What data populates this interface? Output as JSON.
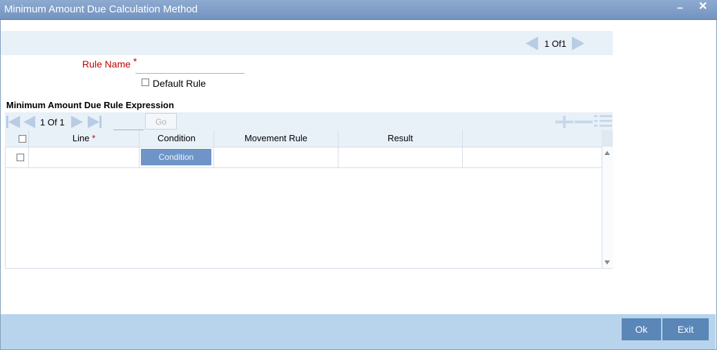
{
  "window": {
    "title": "Minimum Amount Due Calculation Method",
    "minimize_icon": "minimize-icon",
    "close_icon": "close-icon"
  },
  "record_nav": {
    "current": "1",
    "of_label": "Of",
    "total": "1"
  },
  "form": {
    "rule_name_label": "Rule Name",
    "required_mark": "*",
    "rule_name_value": "",
    "default_rule_label": "Default Rule",
    "default_rule_checked": false
  },
  "section": {
    "title": "Minimum Amount Due Rule Expression"
  },
  "grid": {
    "page_current": "1",
    "page_of": "Of",
    "page_total": "1",
    "go_label": "Go",
    "page_input_value": "",
    "columns": [
      {
        "label": "Line",
        "required": "*"
      },
      {
        "label": "Condition"
      },
      {
        "label": "Movement Rule"
      },
      {
        "label": "Result"
      }
    ],
    "rows": [
      {
        "line": "",
        "condition_button": "Condition",
        "movement_rule": "",
        "result": ""
      }
    ],
    "toolbar_icons": [
      "add-row-icon",
      "delete-row-icon",
      "view-row-icon"
    ]
  },
  "footer": {
    "ok_label": "Ok",
    "exit_label": "Exit"
  },
  "colors": {
    "titlebar": "#7f9db9",
    "button": "#5a86b8",
    "footer": "#b8d4ec",
    "required": "#c00000"
  }
}
